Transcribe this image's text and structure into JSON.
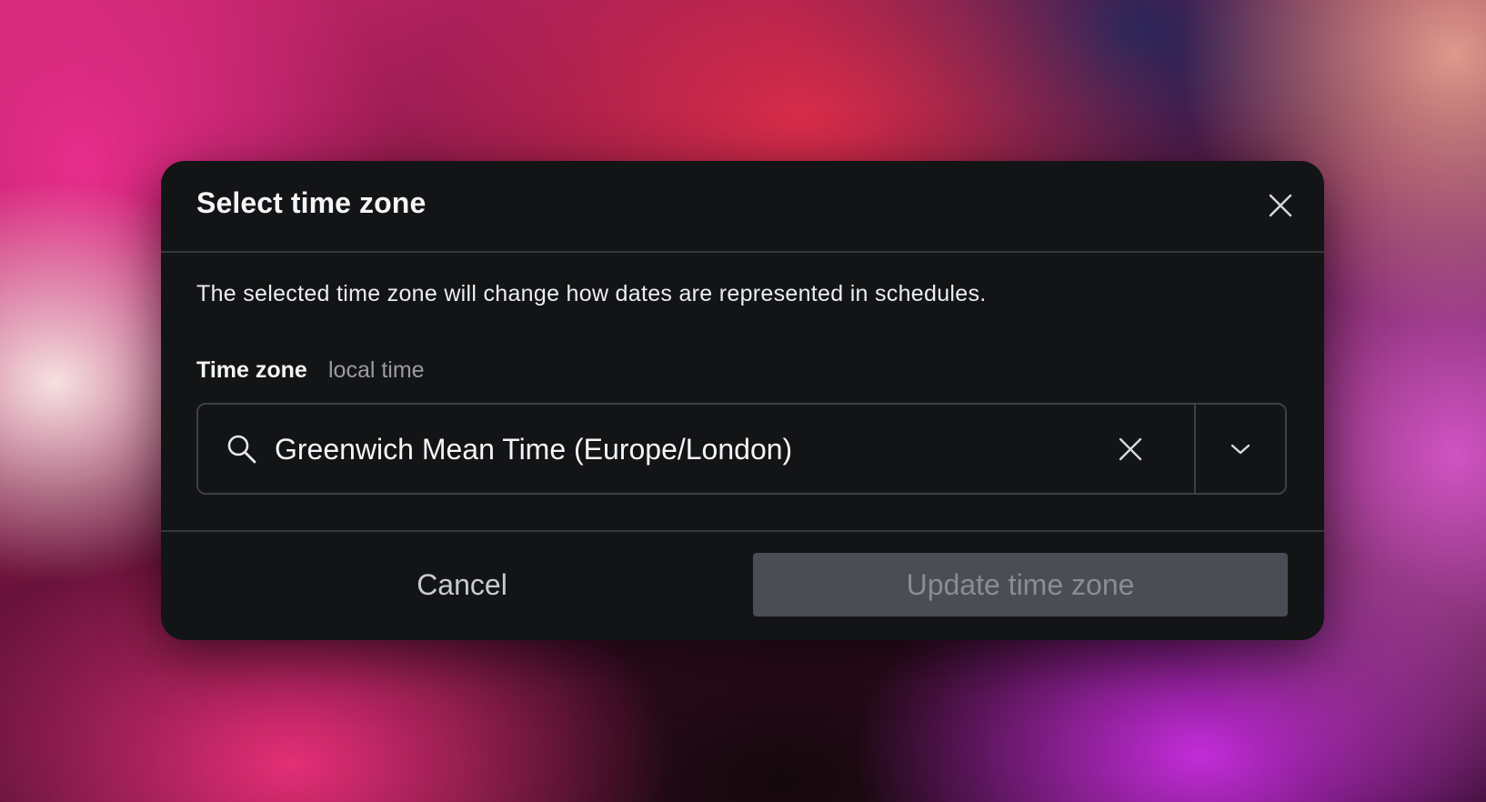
{
  "dialog": {
    "title": "Select time zone",
    "close_icon": "close-icon",
    "description": "The selected time zone will change how dates are represented in schedules.",
    "field": {
      "label": "Time zone",
      "hint": "local time",
      "value": "Greenwich Mean Time (Europe/London)",
      "search_icon": "search-icon",
      "clear_icon": "clear-icon",
      "dropdown_icon": "chevron-down-icon"
    },
    "footer": {
      "cancel_label": "Cancel",
      "submit_label": "Update time zone",
      "submit_disabled": true
    }
  },
  "colors": {
    "dialog_bg": "#131416",
    "border": "#3e4045",
    "disabled_button_bg": "#4a4d53",
    "disabled_button_text": "#8a8d93"
  }
}
